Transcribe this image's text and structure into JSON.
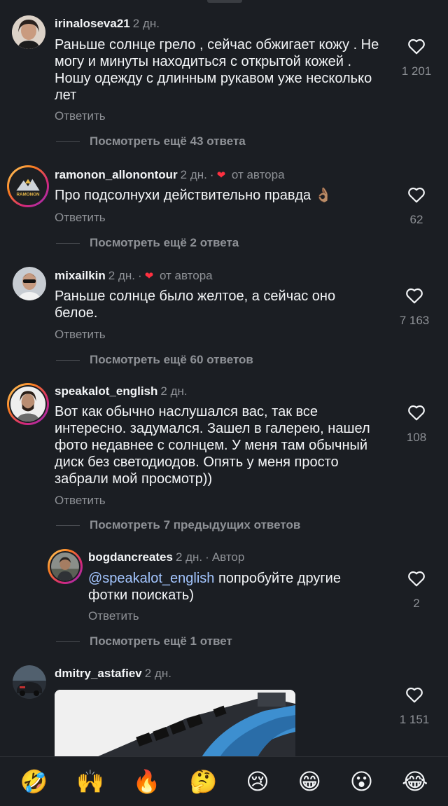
{
  "comments": [
    {
      "username": "irinaloseva21",
      "time": "2 дн.",
      "text": "Раньше солнце грело , сейчас обжигает кожу . Не могу и минуты находиться с открытой кожей .  Ношу одежду с длинным рукавом уже несколько лет",
      "reply_label": "Ответить",
      "likes": "1 201",
      "more_replies": "Посмотреть ещё 43 ответа"
    },
    {
      "username": "ramonon_allonontour",
      "time": "2 дн.",
      "liked_by_author": "от автора",
      "text": "Про подсолнухи действительно правда 👌🏽",
      "reply_label": "Ответить",
      "likes": "62",
      "more_replies": "Посмотреть ещё 2 ответа"
    },
    {
      "username": "mixailkin",
      "time": "2 дн.",
      "liked_by_author": "от автора",
      "text": "Раньше солнце было желтое, а сейчас оно белое.",
      "reply_label": "Ответить",
      "likes": "7 163",
      "more_replies": "Посмотреть ещё 60 ответов"
    },
    {
      "username": "speakalot_english",
      "time": "2 дн.",
      "text": "Вот как обычно наслушался вас, так все интересно. задумался. Зашел в галерею, нашел фото недавнее с солнцем. У меня там обычный диск без светодиодов. Опять у меня просто забрали мой просмотр))",
      "reply_label": "Ответить",
      "likes": "108",
      "previous_replies": "Посмотреть 7 предыдущих ответов",
      "reply": {
        "username": "bogdancreates",
        "time": "2 дн.",
        "author_tag": "Автор",
        "mention": "@speakalot_english",
        "text": " попробуйте другие фотки поискать)",
        "reply_label": "Ответить",
        "likes": "2",
        "more_replies": "Посмотреть ещё 1 ответ"
      }
    },
    {
      "username": "dmitry_astafiev",
      "time": "2 дн.",
      "likes": "1 151"
    }
  ],
  "avatar_texts": {
    "ramonon": "RAMONON"
  },
  "emoji_bar": [
    "🤣",
    "🙌",
    "🔥",
    "🤔",
    "😢",
    "😁",
    "😮",
    "😂"
  ],
  "colors": {
    "background": "#1b1e23",
    "muted": "#8e9196",
    "mention": "#a4c6ff",
    "heart_red": "#ff3040"
  }
}
